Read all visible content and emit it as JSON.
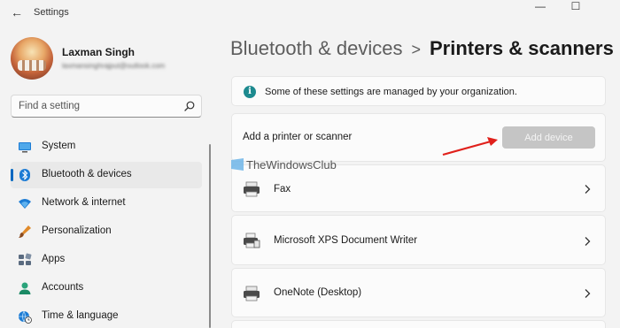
{
  "window": {
    "title": "Settings",
    "back_glyph": "←",
    "minimize_glyph": "—",
    "maximize_glyph": "☐"
  },
  "profile": {
    "name": "Laxman Singh",
    "email": "laxmansinghrajput@outlook.com"
  },
  "search": {
    "placeholder": "Find a setting",
    "icon": "search-icon"
  },
  "sidebar": {
    "items": [
      {
        "label": "System",
        "icon": "monitor-icon",
        "selected": false
      },
      {
        "label": "Bluetooth & devices",
        "icon": "bluetooth-icon",
        "selected": true
      },
      {
        "label": "Network & internet",
        "icon": "wifi-icon",
        "selected": false
      },
      {
        "label": "Personalization",
        "icon": "paintbrush-icon",
        "selected": false
      },
      {
        "label": "Apps",
        "icon": "apps-icon",
        "selected": false
      },
      {
        "label": "Accounts",
        "icon": "person-icon",
        "selected": false
      },
      {
        "label": "Time & language",
        "icon": "globe-clock-icon",
        "selected": false
      }
    ]
  },
  "breadcrumb": {
    "parent": "Bluetooth & devices",
    "separator": ">",
    "current": "Printers & scanners"
  },
  "info_banner": {
    "text": "Some of these settings are managed by your organization.",
    "icon": "info-icon",
    "icon_glyph": "i"
  },
  "add_printer": {
    "label": "Add a printer or scanner",
    "button_label": "Add device",
    "button_enabled": false
  },
  "devices": [
    {
      "label": "Fax",
      "icon": "fax-printer-icon"
    },
    {
      "label": "Microsoft XPS Document Writer",
      "icon": "xps-printer-icon"
    },
    {
      "label": "OneNote (Desktop)",
      "icon": "printer-icon"
    }
  ],
  "watermark": {
    "text": "TheWindowsClub"
  },
  "colors": {
    "accent": "#0067c0",
    "annotation_arrow": "#e0201b",
    "info_icon": "#1d8a8f",
    "disabled_button": "#c5c5c5"
  }
}
